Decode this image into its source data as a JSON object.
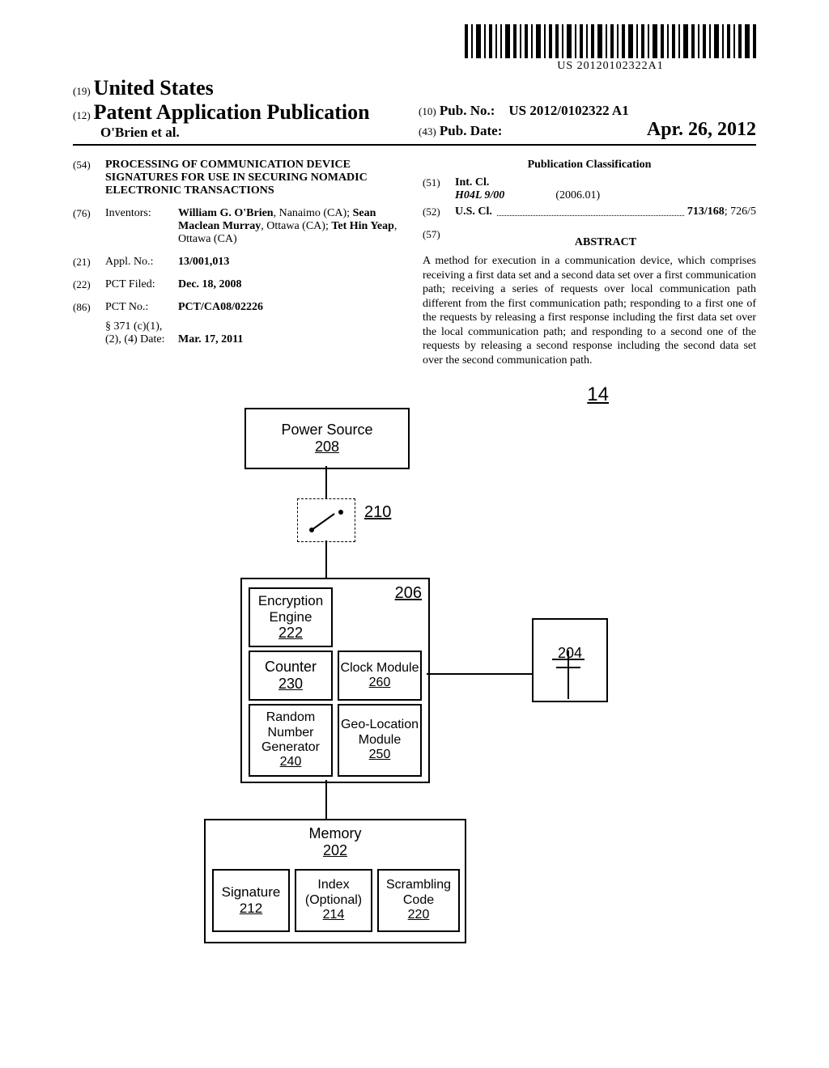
{
  "barcode_text": "US 20120102322A1",
  "header": {
    "country_num": "(19)",
    "country": "United States",
    "doctype_num": "(12)",
    "doctype": "Patent Application Publication",
    "authors": "O'Brien et al.",
    "pubno_num": "(10)",
    "pubno_label": "Pub. No.:",
    "pubno": "US 2012/0102322 A1",
    "pubdate_num": "(43)",
    "pubdate_label": "Pub. Date:",
    "pubdate": "Apr. 26, 2012"
  },
  "left": {
    "title_num": "(54)",
    "title": "PROCESSING OF COMMUNICATION DEVICE SIGNATURES FOR USE IN SECURING NOMADIC ELECTRONIC TRANSACTIONS",
    "inv_num": "(76)",
    "inv_label": "Inventors:",
    "inventors_html": "William G. O'Brien, Nanaimo (CA); Sean Maclean Murray, Ottawa (CA); Tet Hin Yeap, Ottawa (CA)",
    "inv_bold": [
      "William G. O'Brien",
      "Sean Maclean Murray",
      "Tet Hin Yeap"
    ],
    "appl_num": "(21)",
    "appl_label": "Appl. No.:",
    "appl_val": "13/001,013",
    "pct_filed_num": "(22)",
    "pct_filed_label": "PCT Filed:",
    "pct_filed_val": "Dec. 18, 2008",
    "pct_no_num": "(86)",
    "pct_no_label": "PCT No.:",
    "pct_no_val": "PCT/CA08/02226",
    "s371_label1": "§ 371 (c)(1),",
    "s371_label2": "(2), (4) Date:",
    "s371_val": "Mar. 17, 2011"
  },
  "right": {
    "pub_class": "Publication Classification",
    "intcl_num": "(51)",
    "intcl_label": "Int. Cl.",
    "intcl_code": "H04L 9/00",
    "intcl_ver": "(2006.01)",
    "uscl_num": "(52)",
    "uscl_label": "U.S. Cl.",
    "uscl_val": "713/168; 726/5",
    "abs_num": "(57)",
    "abs_label": "ABSTRACT",
    "abstract": "A method for execution in a communication device, which comprises receiving a first data set and a second data set over a first communication path; receiving a series of requests over local communication path different from the first communication path; responding to a first one of the requests by releasing a first response including the first data set over the local communication path; and responding to a second one of the requests by releasing a second response including the second data set over the second communication path."
  },
  "figure": {
    "ref14": "14",
    "power_name": "Power Source",
    "power_num": "208",
    "switch_ref": "210",
    "proc_ref": "206",
    "enc_name": "Encryption Engine",
    "enc_num": "222",
    "counter_name": "Counter",
    "counter_num": "230",
    "clock_name": "Clock Module",
    "clock_num": "260",
    "rng_name": "Random Number Generator",
    "rng_num": "240",
    "geo_name": "Geo-Location Module",
    "geo_num": "250",
    "mem_name": "Memory",
    "mem_num": "202",
    "sig_name": "Signature",
    "sig_num": "212",
    "idx_name": "Index (Optional)",
    "idx_num": "214",
    "scr_name": "Scrambling Code",
    "scr_num": "220",
    "ant_ref": "204"
  }
}
